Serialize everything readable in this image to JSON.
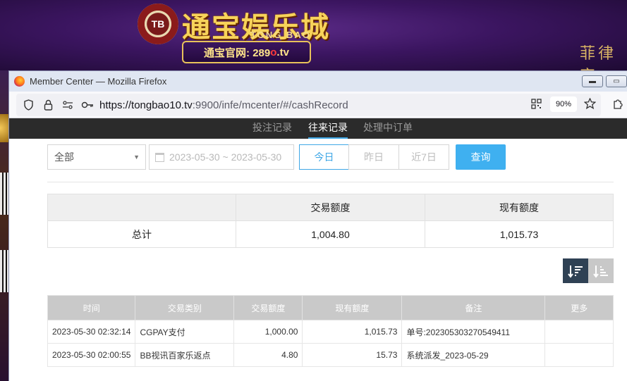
{
  "banner": {
    "chip_text": "TB",
    "title": "通宝娱乐城",
    "subtitle": "TONG BAO",
    "official_prefix": "通宝官网: 289",
    "official_red": "o",
    "official_suffix": ".tv",
    "deco_right": "菲律宾"
  },
  "window": {
    "title": "Member Center — Mozilla Firefox",
    "url_host": "https://tongbao10.tv",
    "url_rest": ":9900/infe/mcenter/#/cashRecord",
    "zoom": "90%"
  },
  "nav": {
    "items": [
      {
        "label": "投注记录"
      },
      {
        "label": "往来记录"
      },
      {
        "label": "处理中订单"
      }
    ]
  },
  "filters": {
    "type_select": "全部",
    "date_range": "2023-05-30 ~ 2023-05-30",
    "quick": [
      "今日",
      "昨日",
      "近7日"
    ],
    "query_label": "查询"
  },
  "summary": {
    "headers": [
      "",
      "交易额度",
      "现有额度"
    ],
    "row_label": "总计",
    "trade_total": "1,004.80",
    "balance_total": "1,015.73"
  },
  "records": {
    "headers": [
      "时间",
      "交易类别",
      "交易额度",
      "现有额度",
      "备注",
      "更多"
    ],
    "rows": [
      [
        "2023-05-30 02:32:14",
        "CGPAY支付",
        "1,000.00",
        "1,015.73",
        "单号:202305303270549411",
        ""
      ],
      [
        "2023-05-30 02:00:55",
        "BB视讯百家乐返点",
        "4.80",
        "15.73",
        "系统派发_2023-05-29",
        ""
      ]
    ]
  },
  "colors": {
    "accent": "#3fa7e6",
    "query_button": "#3fb0f0",
    "nav_bg": "#2b2b2b",
    "sort_active": "#2f4154"
  }
}
